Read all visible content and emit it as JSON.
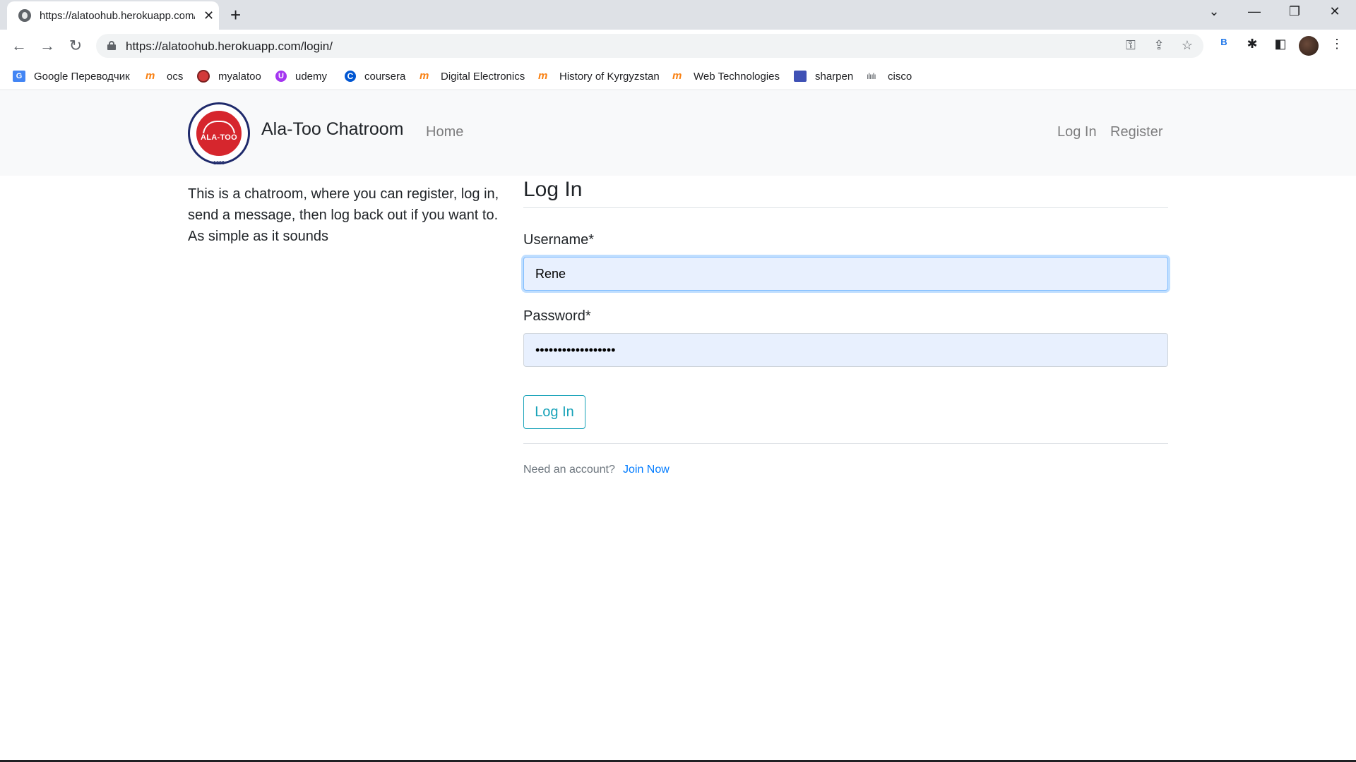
{
  "browser": {
    "tab_title": "https://alatoohub.herokuapp.com/login/",
    "tab_close": "✕",
    "new_tab": "+",
    "url": "https://alatoohub.herokuapp.com/login/",
    "profile_badge": "B",
    "window_controls": {
      "tab_search": "⌄",
      "minimize": "—",
      "restore": "❐",
      "close": "✕"
    },
    "icons": [
      "globe-icon",
      "back-icon",
      "forward-icon",
      "reload-icon",
      "lock-icon",
      "key-icon",
      "share-icon",
      "star-icon",
      "extensions-icon",
      "side-panel-icon",
      "menu-icon"
    ]
  },
  "bookmarks": [
    {
      "label": "Google Переводчик",
      "icon": "translate-icon"
    },
    {
      "label": "ocs",
      "icon": "moodle-icon"
    },
    {
      "label": "myalatoo",
      "icon": "alatoo-icon"
    },
    {
      "label": "udemy",
      "icon": "udemy-icon"
    },
    {
      "label": "coursera",
      "icon": "coursera-icon"
    },
    {
      "label": "Digital Electronics",
      "icon": "moodle-icon"
    },
    {
      "label": "History of Kyrgyzstan",
      "icon": "moodle-icon"
    },
    {
      "label": "Web Technologies",
      "icon": "moodle-icon"
    },
    {
      "label": "sharpen",
      "icon": "sharpen-icon"
    },
    {
      "label": "cisco",
      "icon": "cisco-icon"
    }
  ],
  "navbar": {
    "brand": "Ala-Too Chatroom",
    "logo_text": "ALA-TOO",
    "logo_year": "1996",
    "home": "Home",
    "login": "Log In",
    "register": "Register"
  },
  "intro": {
    "text": "This is a chatroom, where you can register, log in, send a message, then log back out if you want to. As simple as it sounds"
  },
  "login_form": {
    "legend": "Log In",
    "username_label": "Username*",
    "username_value": "Rene",
    "password_label": "Password*",
    "password_value": "••••••••••••••••••",
    "submit": "Log In",
    "need_account": "Need an account?",
    "join_now": "Join Now"
  },
  "colors": {
    "navbar_bg": "#f8f9fa",
    "button_outline": "#17a2b8",
    "link": "#007bff",
    "autofill_bg": "#e8f0fe"
  }
}
